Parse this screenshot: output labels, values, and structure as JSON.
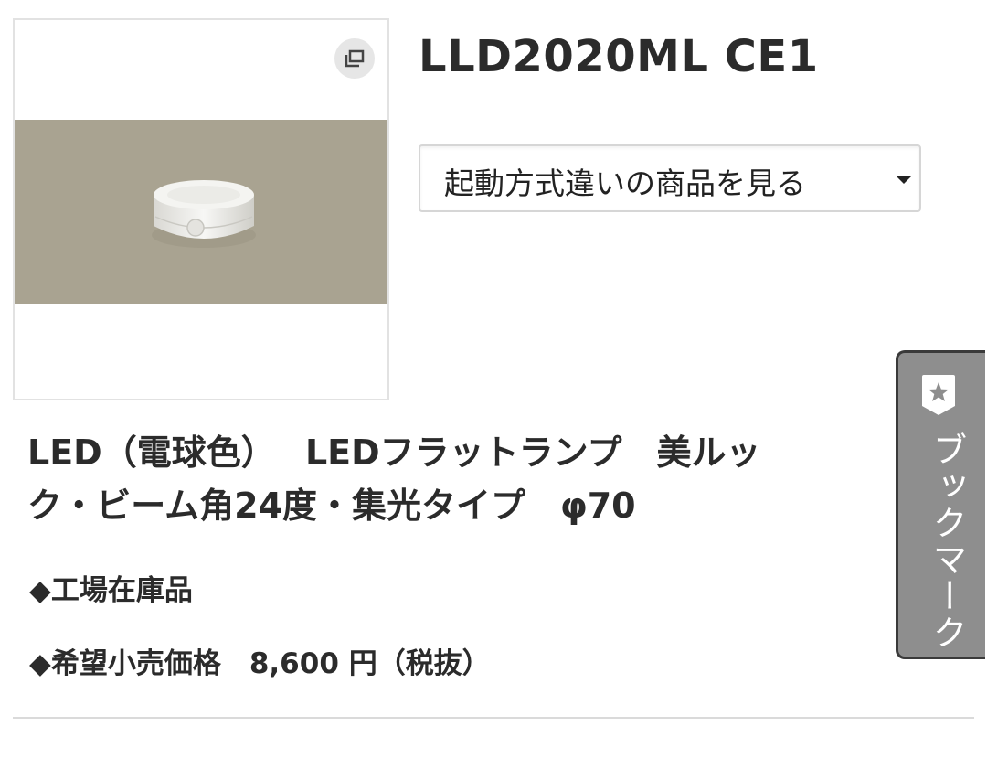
{
  "product": {
    "code": "LLD2020ML CE1",
    "name_line1": "LED（電球色）　 LEDフラットランプ　美ルッ",
    "name_line2": "ク・ビーム角24度・集光タイプ　φ70",
    "stock_status": "◆工場在庫品",
    "price_label": "◆希望小売価格　8,600 円（税抜）"
  },
  "variant_select": {
    "selected": "起動方式違いの商品を見る"
  },
  "image": {
    "zoom_icon": "enlarge-icon",
    "band_color": "#a9a391"
  },
  "bookmark": {
    "label": "ブックマーク",
    "icon": "bookmark-star-icon"
  }
}
